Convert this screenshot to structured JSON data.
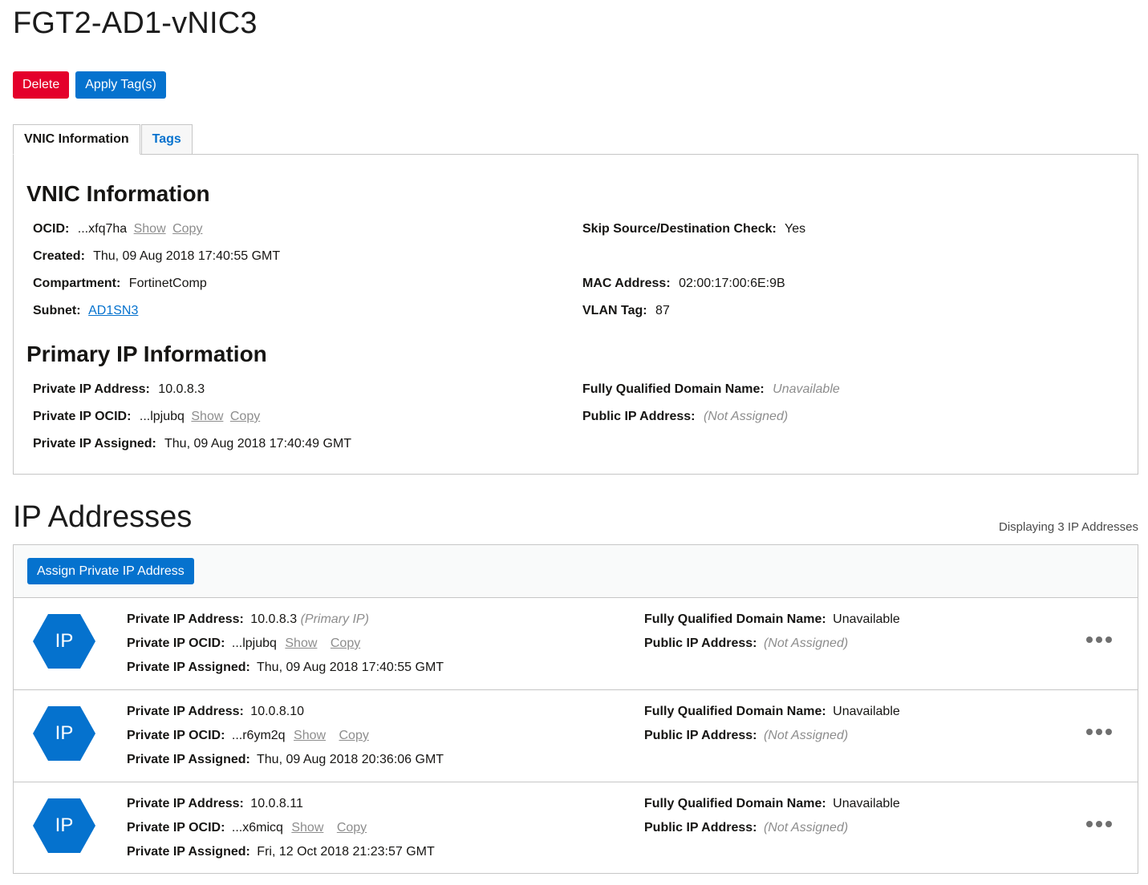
{
  "page": {
    "title": "FGT2-AD1-vNIC3"
  },
  "actions": {
    "delete_label": "Delete",
    "apply_tags_label": "Apply Tag(s)"
  },
  "tabs": [
    {
      "label": "VNIC Information",
      "active": true
    },
    {
      "label": "Tags",
      "active": false
    }
  ],
  "vnic_info": {
    "heading": "VNIC Information",
    "ocid_label": "OCID:",
    "ocid_value": "...xfq7ha",
    "show_label": "Show",
    "copy_label": "Copy",
    "created_label": "Created:",
    "created_value": "Thu, 09 Aug 2018 17:40:55 GMT",
    "compartment_label": "Compartment:",
    "compartment_value": "FortinetComp",
    "subnet_label": "Subnet:",
    "subnet_value": "AD1SN3",
    "skip_check_label": "Skip Source/Destination Check:",
    "skip_check_value": "Yes",
    "mac_label": "MAC Address:",
    "mac_value": "02:00:17:00:6E:9B",
    "vlan_label": "VLAN Tag:",
    "vlan_value": "87"
  },
  "primary_ip": {
    "heading": "Primary IP Information",
    "private_ip_label": "Private IP Address:",
    "private_ip_value": "10.0.8.3",
    "ocid_label": "Private IP OCID:",
    "ocid_value": "...lpjubq",
    "show_label": "Show",
    "copy_label": "Copy",
    "assigned_label": "Private IP Assigned:",
    "assigned_value": "Thu, 09 Aug 2018 17:40:49 GMT",
    "fqdn_label": "Fully Qualified Domain Name:",
    "fqdn_value": "Unavailable",
    "public_ip_label": "Public IP Address:",
    "public_ip_value": "(Not Assigned)"
  },
  "ip_addresses": {
    "heading": "IP Addresses",
    "count_text": "Displaying 3 IP Addresses",
    "assign_button_label": "Assign Private IP Address",
    "icon_text": "IP",
    "labels": {
      "address": "Private IP Address:",
      "ocid": "Private IP OCID:",
      "assigned": "Private IP Assigned:",
      "fqdn": "Fully Qualified Domain Name:",
      "public": "Public IP Address:",
      "show": "Show",
      "copy": "Copy"
    },
    "rows": [
      {
        "address": "10.0.8.3",
        "note": "(Primary IP)",
        "ocid": "...lpjubq",
        "assigned": "Thu, 09 Aug 2018 17:40:55 GMT",
        "fqdn": "Unavailable",
        "public": "(Not Assigned)"
      },
      {
        "address": "10.0.8.10",
        "note": "",
        "ocid": "...r6ym2q",
        "assigned": "Thu, 09 Aug 2018 20:36:06 GMT",
        "fqdn": "Unavailable",
        "public": "(Not Assigned)"
      },
      {
        "address": "10.0.8.11",
        "note": "",
        "ocid": "...x6micq",
        "assigned": "Fri, 12 Oct 2018 21:23:57 GMT",
        "fqdn": "Unavailable",
        "public": "(Not Assigned)"
      }
    ]
  },
  "colors": {
    "primary": "#0572ce",
    "danger": "#e4002b",
    "muted": "#8d8d8d"
  }
}
